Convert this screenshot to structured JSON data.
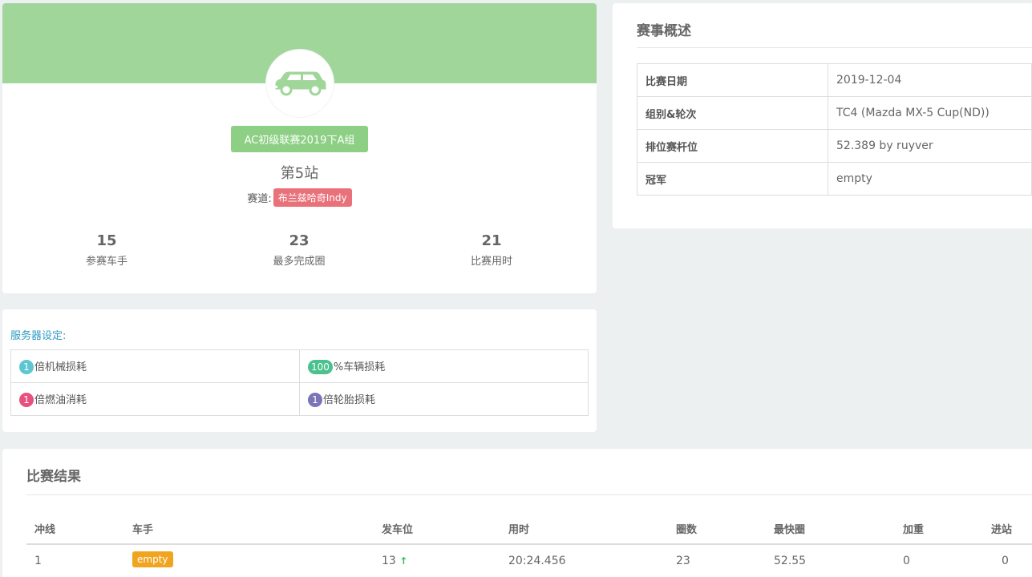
{
  "profile": {
    "league": "AC初级联赛2019下A组",
    "station": "第5站",
    "track_label": "赛道:",
    "track": "布兰兹哈奇Indy",
    "stats": [
      {
        "value": "15",
        "label": "参赛车手"
      },
      {
        "value": "23",
        "label": "最多完成圈"
      },
      {
        "value": "21",
        "label": "比赛用时"
      }
    ]
  },
  "server": {
    "title": "服务器设定:",
    "items": [
      {
        "value": "1",
        "text": "倍机械损耗",
        "color": "#5ec6d0"
      },
      {
        "value": "100",
        "text": "%车辆损耗",
        "color": "#4ac18e"
      },
      {
        "value": "1",
        "text": "倍燃油消耗",
        "color": "#e8517f"
      },
      {
        "value": "1",
        "text": "倍轮胎损耗",
        "color": "#7b75b7"
      }
    ]
  },
  "overview": {
    "title": "赛事概述",
    "rows": [
      {
        "key": "比赛日期",
        "value": "2019-12-04"
      },
      {
        "key": "组别&轮次",
        "value": "TC4 (Mazda MX-5 Cup(ND))"
      },
      {
        "key": "排位赛杆位",
        "value": "52.389 by ruyver"
      },
      {
        "key": "冠军",
        "value": "empty"
      }
    ]
  },
  "results": {
    "title": "比赛结果",
    "columns": [
      "冲线",
      "车手",
      "发车位",
      "用时",
      "圈数",
      "最快圈",
      "加重",
      "进站"
    ],
    "rows": [
      {
        "finish": "1",
        "driver": "empty",
        "grid": "13",
        "time": "20:24.456",
        "laps": "23",
        "best": "52.55",
        "ballast": "0",
        "pit": "0"
      }
    ]
  },
  "colors": {
    "banner": "#a1d69b",
    "league_tag": "#8dcf84",
    "track_badge": "#e9717a",
    "driver_tag": "#f1a41f",
    "arrow": "#2db95b"
  }
}
